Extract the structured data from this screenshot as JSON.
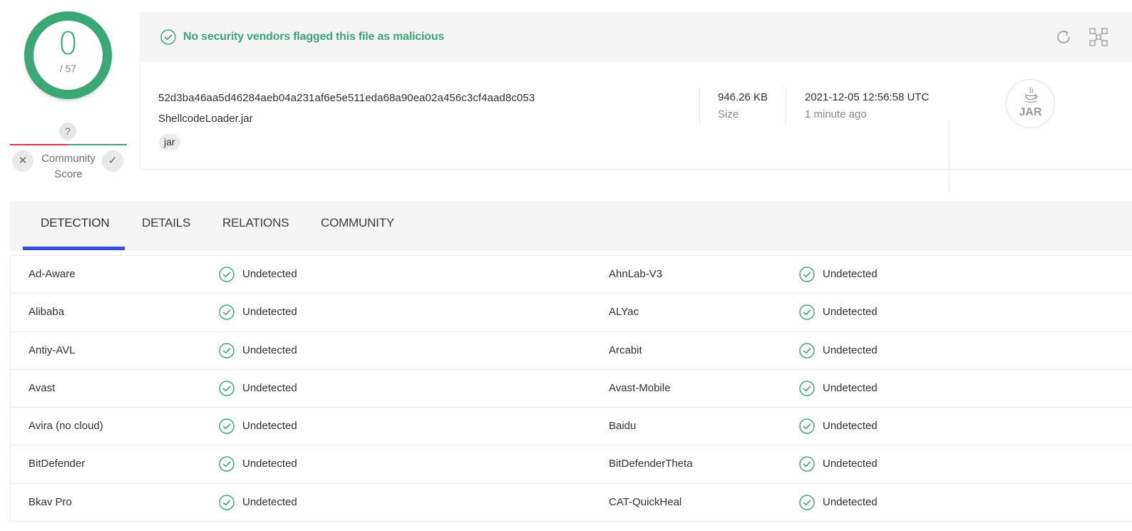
{
  "score": {
    "detections": "0",
    "total": "/ 57"
  },
  "community": {
    "marker": "?",
    "label": "Community Score"
  },
  "banner": {
    "text": "No security vendors flagged this file as malicious"
  },
  "file": {
    "hash": "52d3ba46aa5d46284aeb04a231af6e5e511eda68a90ea02a456c3cf4aad8c053",
    "name": "ShellcodeLoader.jar",
    "tag": "jar",
    "size_value": "946.26 KB",
    "size_label": "Size",
    "date_value": "2021-12-05 12:56:58 UTC",
    "date_relative": "1 minute ago",
    "type_label": "JAR"
  },
  "tabs": [
    {
      "label": "DETECTION",
      "active": true
    },
    {
      "label": "DETAILS"
    },
    {
      "label": "RELATIONS"
    },
    {
      "label": "COMMUNITY"
    }
  ],
  "detections": [
    {
      "left": {
        "engine": "Ad-Aware",
        "result": "Undetected"
      },
      "right": {
        "engine": "AhnLab-V3",
        "result": "Undetected"
      }
    },
    {
      "left": {
        "engine": "Alibaba",
        "result": "Undetected"
      },
      "right": {
        "engine": "ALYac",
        "result": "Undetected"
      }
    },
    {
      "left": {
        "engine": "Antiy-AVL",
        "result": "Undetected"
      },
      "right": {
        "engine": "Arcabit",
        "result": "Undetected"
      }
    },
    {
      "left": {
        "engine": "Avast",
        "result": "Undetected"
      },
      "right": {
        "engine": "Avast-Mobile",
        "result": "Undetected"
      }
    },
    {
      "left": {
        "engine": "Avira (no cloud)",
        "result": "Undetected"
      },
      "right": {
        "engine": "Baidu",
        "result": "Undetected"
      }
    },
    {
      "left": {
        "engine": "BitDefender",
        "result": "Undetected"
      },
      "right": {
        "engine": "BitDefenderTheta",
        "result": "Undetected"
      }
    },
    {
      "left": {
        "engine": "Bkav Pro",
        "result": "Undetected"
      },
      "right": {
        "engine": "CAT-QuickHeal",
        "result": "Undetected"
      }
    }
  ],
  "colors": {
    "clean": "#3aa776",
    "malicious": "#e2334f",
    "tab_accent": "#3b4bdb"
  },
  "icons": {
    "banner": "check-circle-icon",
    "refresh": "refresh-icon",
    "graph": "graph-view-icon",
    "vote_down": "close-icon",
    "vote_up": "check-icon"
  }
}
